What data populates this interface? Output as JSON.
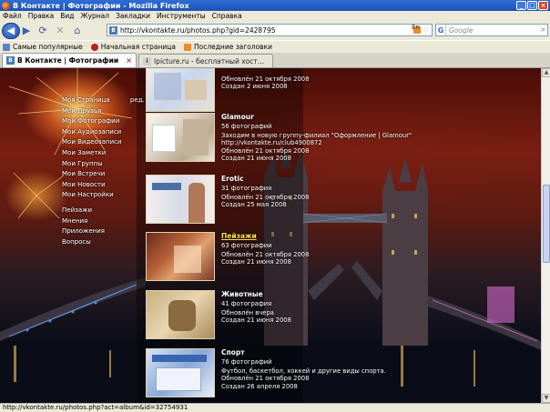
{
  "window": {
    "title": "В Контакте | Фотографии - Mozilla Firefox"
  },
  "menu": [
    "Файл",
    "Правка",
    "Вид",
    "Журнал",
    "Закладки",
    "Инструменты",
    "Справка"
  ],
  "nav": {
    "url": "http://vkontakte.ru/photos.php?gid=2428795",
    "lang": "En",
    "search_placeholder": "Google"
  },
  "bookmarks": [
    "Самые популярные",
    "Начальная страница",
    "Последние заголовки"
  ],
  "tabs": [
    {
      "title": "В Контакте | Фотографии"
    },
    {
      "title": "Ipicture.ru - бесплатный хостинг ф..."
    }
  ],
  "sidenav": {
    "items": [
      "Моя Страница",
      "Мои Друзья",
      "Мои Фотографии",
      "Мои Аудиозаписи",
      "Мои Видеозаписи",
      "Мои Заметки",
      "Мои Группы",
      "Мои Встречи",
      "Мои Новости",
      "Мои Настройки"
    ],
    "items2": [
      "Пейзажи",
      "Мнения",
      "Приложения",
      "Вопросы"
    ],
    "edit_label": "ред."
  },
  "albums": [
    {
      "title": "",
      "lines": [
        "Обновлён 21 октября 2008",
        "Создан 2 июня 2008"
      ]
    },
    {
      "title": "Glamour",
      "count": "56 фотографий",
      "lines": [
        "Заходим в новую группу-филиал \"Оформление | Glamour\"",
        "http://vkontakte.ru/club4900872",
        "Обновлён 21 октября 2008",
        "Создан 21 июня 2008"
      ]
    },
    {
      "title": "Erotic",
      "count": "31 фотография",
      "lines": [
        "Обновлён 21 октября 2008",
        "Создан 25 мая 2008"
      ]
    },
    {
      "title": "Пейзажи",
      "count": "63 фотографии",
      "lines": [
        "Обновлён 21 октября 2008",
        "Создан 21 июня 2008"
      ]
    },
    {
      "title": "Животные",
      "count": "41 фотография",
      "lines": [
        "Обновлён вчера",
        "Создан 21 июня 2008"
      ]
    },
    {
      "title": "Спорт",
      "count": "76 фотографий",
      "lines": [
        "Футбол, баскетбол, хоккей и другие виды спорта.",
        "Обновлён 21 октября 2008",
        "Создан 26 апреля 2008"
      ]
    }
  ],
  "status": {
    "text": "http://vkontakte.ru/photos.php?act=album&id=32754931"
  }
}
